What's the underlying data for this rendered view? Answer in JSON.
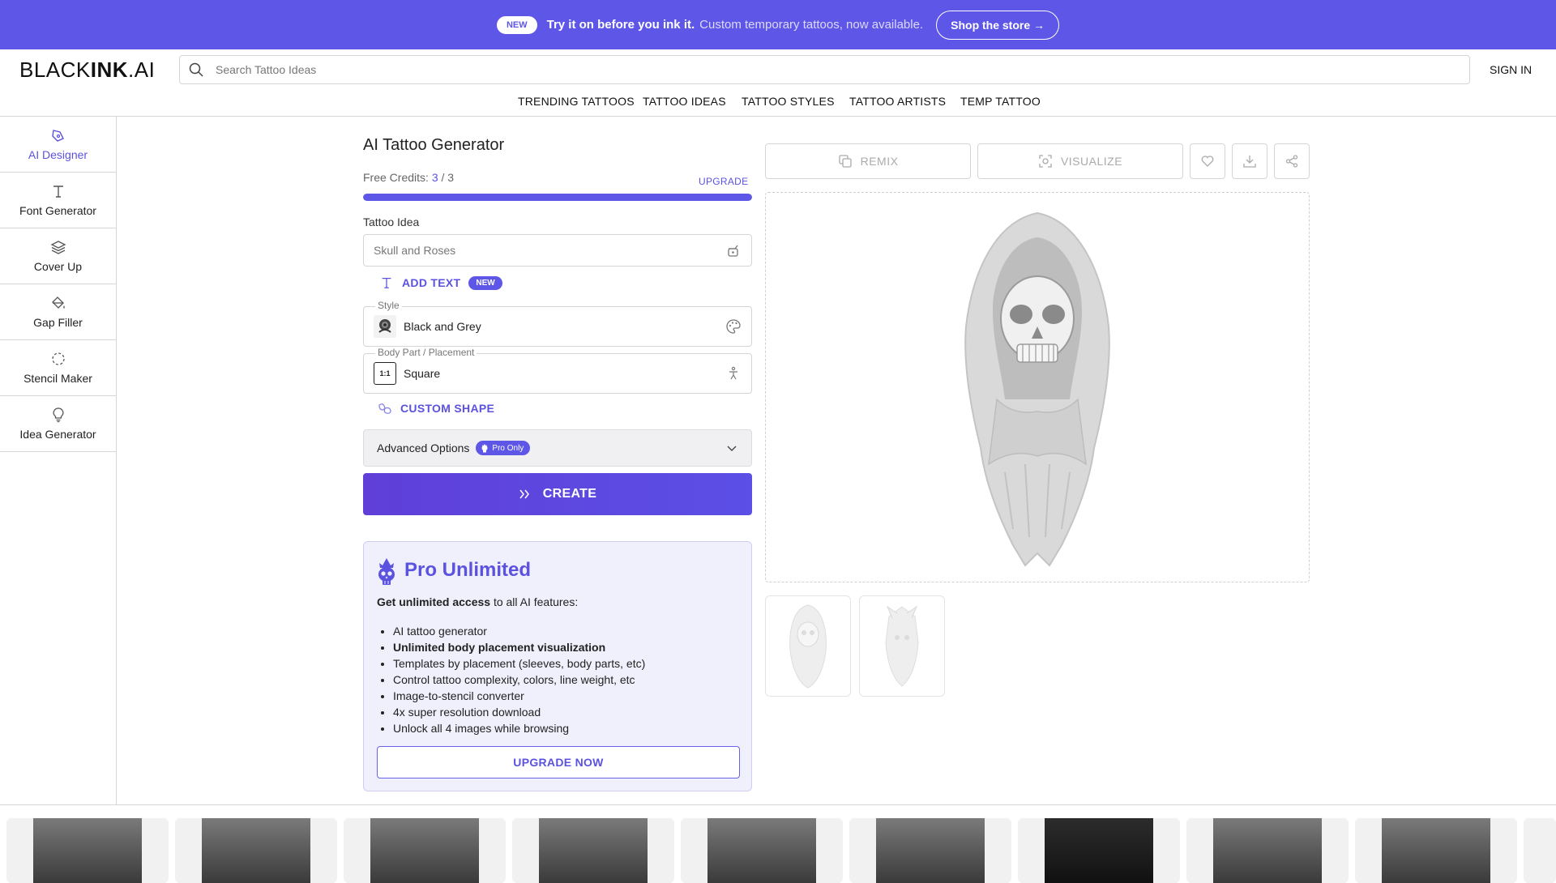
{
  "banner": {
    "new_badge": "NEW",
    "headline": "Try it on before you ink it.",
    "subline": "Custom temporary tattoos, now available.",
    "shop_button": "Shop the store →"
  },
  "header": {
    "logo_light": "BLACK",
    "logo_bold": "INK",
    "logo_suffix": ".AI",
    "search_placeholder": "Search Tattoo Ideas",
    "signin": "SIGN IN"
  },
  "nav": [
    "TRENDING TATTOOS",
    "TATTOO IDEAS",
    "TATTOO STYLES",
    "TATTOO ARTISTS",
    "TEMP TATTOO"
  ],
  "sidebar": {
    "items": [
      {
        "label": "AI Designer",
        "icon": "pen-nib-icon",
        "active": true
      },
      {
        "label": "Font Generator",
        "icon": "text-icon",
        "active": false
      },
      {
        "label": "Cover Up",
        "icon": "layers-icon",
        "active": false
      },
      {
        "label": "Gap Filler",
        "icon": "paint-bucket-icon",
        "active": false
      },
      {
        "label": "Stencil Maker",
        "icon": "dashed-circle-icon",
        "active": false
      },
      {
        "label": "Idea Generator",
        "icon": "lightbulb-icon",
        "active": false
      }
    ]
  },
  "form": {
    "title": "AI Tattoo Generator",
    "credits_label": "Free Credits:",
    "credits_used": "3",
    "credits_sep": "/",
    "credits_total": "3",
    "credits_fraction": 1.0,
    "upgrade_link": "UPGRADE",
    "idea_label": "Tattoo Idea",
    "idea_placeholder": "Skull and Roses",
    "add_text": "ADD TEXT",
    "add_text_badge": "NEW",
    "style_legend": "Style",
    "style_value": "Black and Grey",
    "placement_legend": "Body Part / Placement",
    "placement_value": "Square",
    "placement_thumb": "1:1",
    "custom_shape": "CUSTOM SHAPE",
    "advanced": "Advanced Options",
    "pro_only": "Pro Only",
    "create": "CREATE"
  },
  "pro_card": {
    "title": "Pro Unlimited",
    "lead_bold": "Get unlimited access",
    "lead_rest": " to all AI features:",
    "features": [
      {
        "text": "AI tattoo generator",
        "bold": false
      },
      {
        "text": "Unlimited body placement visualization",
        "bold": true
      },
      {
        "text": "Templates by placement (sleeves, body parts, etc)",
        "bold": false
      },
      {
        "text": "Control tattoo complexity, colors, line weight, etc",
        "bold": false
      },
      {
        "text": "Image-to-stencil converter",
        "bold": false
      },
      {
        "text": "4x super resolution download",
        "bold": false
      },
      {
        "text": "Unlock all 4 images while browsing",
        "bold": false
      }
    ],
    "button": "UPGRADE NOW"
  },
  "toolbar": {
    "remix": "REMIX",
    "visualize": "VISUALIZE"
  },
  "colors": {
    "accent": "#5e56e6",
    "banner": "#5e56e6",
    "card_bg": "#f0f0fc"
  }
}
